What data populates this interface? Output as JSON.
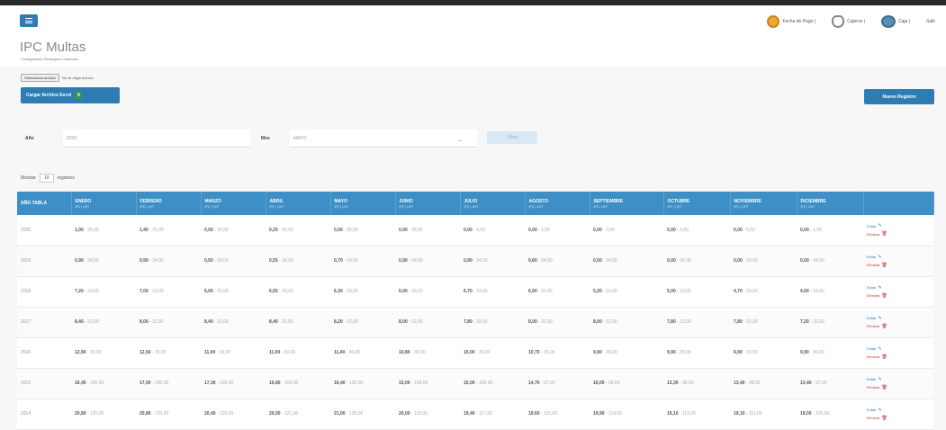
{
  "topbar": {
    "links": [
      {
        "label": "Fecha de Pago |",
        "icon": "clock-icon"
      },
      {
        "label": "Cajeros |",
        "icon": "user-icon"
      },
      {
        "label": "Caja |",
        "icon": "register-icon"
      },
      {
        "label": "Salir",
        "icon": ""
      }
    ]
  },
  "header": {
    "title": "IPC Multas",
    "subtitle": "Configuración Recargos e Intereses"
  },
  "upload": {
    "file_button": "Seleccionar archivo",
    "file_status": "No se eligió archivo",
    "upload_label": "Cargar Archivo Excel",
    "new_label": "Nuevo Registro"
  },
  "filters": {
    "year_label": "Año",
    "year_value": "2020",
    "month_label": "Mes",
    "month_value": "MAYO",
    "filter_label": "Filtrar"
  },
  "show": {
    "prefix": "Mostrar",
    "value": "10",
    "suffix": "registros"
  },
  "table": {
    "columns": [
      "AÑO TABLA",
      "ENERO",
      "FEBRERO",
      "MARZO",
      "ABRIL",
      "MAYO",
      "JUNIO",
      "JULIO",
      "AGOSTO",
      "SEPTIEMBRE",
      "OCTUBRE",
      "NOVIEMBRE",
      "DICIEMBRE",
      ""
    ],
    "column_sub": "IPC | UVT",
    "rows": [
      {
        "year": "2020",
        "cells": [
          [
            "1,00",
            "35,00"
          ],
          [
            "1,40",
            "35,00"
          ],
          [
            "0,00",
            "35,00"
          ],
          [
            "0,25",
            "35,00"
          ],
          [
            "0,00",
            "35,00"
          ],
          [
            "0,00",
            "35,00"
          ],
          [
            "0,00",
            "0,00"
          ],
          [
            "0,00",
            "1,00"
          ],
          [
            "0,00",
            "0,00"
          ],
          [
            "0,00",
            "0,00"
          ],
          [
            "0,00",
            "0,00"
          ],
          [
            "0,00",
            "1,00"
          ]
        ]
      },
      {
        "year": "2019",
        "cells": [
          [
            "0,90",
            "34,00"
          ],
          [
            "0,90",
            "34,00"
          ],
          [
            "0,50",
            "34,00"
          ],
          [
            "0,55",
            "34,00"
          ],
          [
            "0,70",
            "34,00"
          ],
          [
            "0,90",
            "34,00"
          ],
          [
            "0,90",
            "34,00"
          ],
          [
            "0,60",
            "34,00"
          ],
          [
            "0,50",
            "34,00"
          ],
          [
            "0,00",
            "34,00"
          ],
          [
            "0,00",
            "34,00"
          ],
          [
            "0,00",
            "34,00"
          ]
        ]
      },
      {
        "year": "2018",
        "cells": [
          [
            "7,20",
            "33,00"
          ],
          [
            "7,00",
            "33,00"
          ],
          [
            "6,00",
            "33,00"
          ],
          [
            "6,55",
            "33,00"
          ],
          [
            "6,30",
            "33,00"
          ],
          [
            "6,00",
            "33,00"
          ],
          [
            "6,70",
            "33,00"
          ],
          [
            "6,00",
            "33,00"
          ],
          [
            "5,20",
            "33,00"
          ],
          [
            "5,00",
            "33,00"
          ],
          [
            "4,70",
            "33,00"
          ],
          [
            "4,00",
            "33,00"
          ]
        ]
      },
      {
        "year": "2017",
        "cells": [
          [
            "8,40",
            "32,00"
          ],
          [
            "8,00",
            "32,00"
          ],
          [
            "8,40",
            "32,00"
          ],
          [
            "8,40",
            "32,00"
          ],
          [
            "8,20",
            "32,00"
          ],
          [
            "8,00",
            "32,00"
          ],
          [
            "7,80",
            "32,00"
          ],
          [
            "8,00",
            "32,00"
          ],
          [
            "8,00",
            "32,00"
          ],
          [
            "7,80",
            "32,00"
          ],
          [
            "7,80",
            "32,00"
          ],
          [
            "7,20",
            "32,00"
          ]
        ]
      },
      {
        "year": "2016",
        "cells": [
          [
            "12,90",
            "30,00"
          ],
          [
            "12,50",
            "30,00"
          ],
          [
            "11,00",
            "30,00"
          ],
          [
            "11,00",
            "30,00"
          ],
          [
            "11,40",
            "30,00"
          ],
          [
            "10,80",
            "30,00"
          ],
          [
            "10,00",
            "30,00"
          ],
          [
            "10,70",
            "30,00"
          ],
          [
            "9,90",
            "30,00"
          ],
          [
            "9,90",
            "30,00"
          ],
          [
            "9,90",
            "30,00"
          ],
          [
            "9,90",
            "30,00"
          ]
        ]
      },
      {
        "year": "2015",
        "cells": [
          [
            "16,40",
            "100,00"
          ],
          [
            "17,00",
            "100,00"
          ],
          [
            "17,30",
            "100,00"
          ],
          [
            "16,80",
            "100,00"
          ],
          [
            "16,40",
            "100,00"
          ],
          [
            "15,00",
            "100,00"
          ],
          [
            "15,00",
            "100,00"
          ],
          [
            "14,70",
            "97,00"
          ],
          [
            "16,00",
            "98,00"
          ],
          [
            "13,30",
            "98,00"
          ],
          [
            "13,40",
            "98,00"
          ],
          [
            "13,40",
            "97,00"
          ]
        ]
      },
      {
        "year": "2014",
        "cells": [
          [
            "20,80",
            "120,00"
          ],
          [
            "20,80",
            "120,00"
          ],
          [
            "20,40",
            "120,00"
          ],
          [
            "20,00",
            "121,00"
          ],
          [
            "21,00",
            "120,00"
          ],
          [
            "20,00",
            "118,00"
          ],
          [
            "19,40",
            "117,00"
          ],
          [
            "19,60",
            "115,00"
          ],
          [
            "19,90",
            "114,00"
          ],
          [
            "19,10",
            "113,00"
          ],
          [
            "19,10",
            "111,00"
          ],
          [
            "19,00",
            "100,00"
          ]
        ]
      }
    ],
    "edit_label": "Editar",
    "delete_label": "Eliminar"
  }
}
